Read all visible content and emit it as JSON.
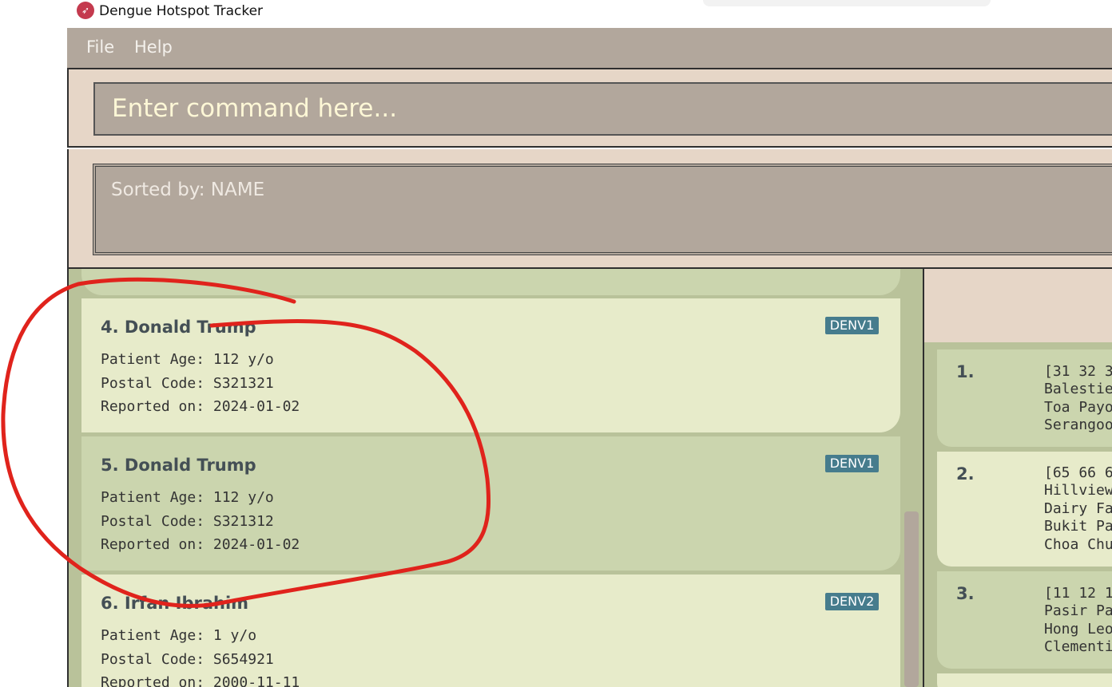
{
  "window": {
    "title": "Dengue Hotspot Tracker"
  },
  "menu": {
    "file": "File",
    "help": "Help"
  },
  "command": {
    "placeholder": "Enter command here..."
  },
  "result": {
    "text": "Sorted by: NAME"
  },
  "patients": [
    {
      "title": "4. Donald Trump",
      "age": "Patient Age: 112 y/o",
      "postal": "Postal Code: S321321",
      "reported": "Reported on: 2024-01-02",
      "tag": "DENV1"
    },
    {
      "title": "5. Donald Trump",
      "age": "Patient Age: 112 y/o",
      "postal": "Postal Code: S321312",
      "reported": "Reported on: 2024-01-02",
      "tag": "DENV1"
    },
    {
      "title": "6. Irfan Ibrahim",
      "age": "Patient Age: 1 y/o",
      "postal": "Postal Code: S654921",
      "reported": "Reported on: 2000-11-11",
      "tag": "DENV2"
    }
  ],
  "hotspots": [
    {
      "num": "1.",
      "lines": [
        "[31 32 3",
        "Balestie",
        "Toa Payo",
        "Serangoo"
      ]
    },
    {
      "num": "2.",
      "lines": [
        "[65 66 6",
        "Hillview",
        "Dairy Fa",
        "Bukit Pa",
        "Choa Chu"
      ]
    },
    {
      "num": "3.",
      "lines": [
        "[11 12 1",
        "Pasir Pa",
        "Hong Leo",
        "Clementi"
      ]
    }
  ],
  "colors": {
    "annotation": "#e0231c",
    "tag": "#467c8d",
    "menubar": "#b2a79c"
  }
}
